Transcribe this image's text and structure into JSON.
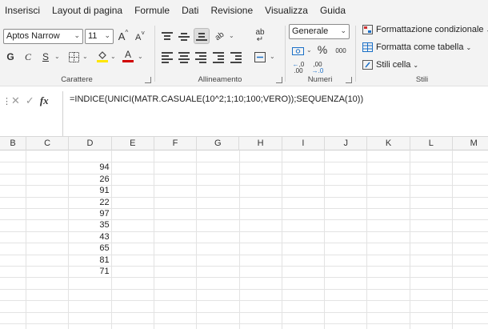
{
  "menu": [
    "Inserisci",
    "Layout di pagina",
    "Formule",
    "Dati",
    "Revisione",
    "Visualizza",
    "Guida"
  ],
  "ribbon": {
    "font": {
      "family": "Aptos Narrow",
      "size": "11",
      "grow": "A",
      "shrink": "A",
      "bold": "G",
      "italic": "C",
      "underline": "S",
      "color_letter": "A",
      "label": "Carattere",
      "highlight_color": "#ffe600",
      "font_color": "#d00000"
    },
    "alignment": {
      "label": "Allineamento"
    },
    "number": {
      "format": "Generale",
      "percent": "%",
      "thousands": "000",
      "inc_decimals": ",0",
      "dec_decimals": ",00",
      "label": "Numeri"
    },
    "styles": {
      "conditional": "Formattazione condizionale",
      "table": "Formatta come tabella",
      "cell": "Stili cella",
      "label": "Stili"
    }
  },
  "formula_bar": {
    "cancel": "✕",
    "confirm": "✓",
    "fx": "fx",
    "formula": "=INDICE(UNICI(MATR.CASUALE(10^2;1;10;100;VERO));SEQUENZA(10))"
  },
  "columns": [
    "B",
    "C",
    "D",
    "E",
    "F",
    "G",
    "H",
    "I",
    "J",
    "K",
    "L",
    "M"
  ],
  "cells_D": [
    "94",
    "26",
    "91",
    "22",
    "97",
    "35",
    "43",
    "65",
    "81",
    "71"
  ]
}
